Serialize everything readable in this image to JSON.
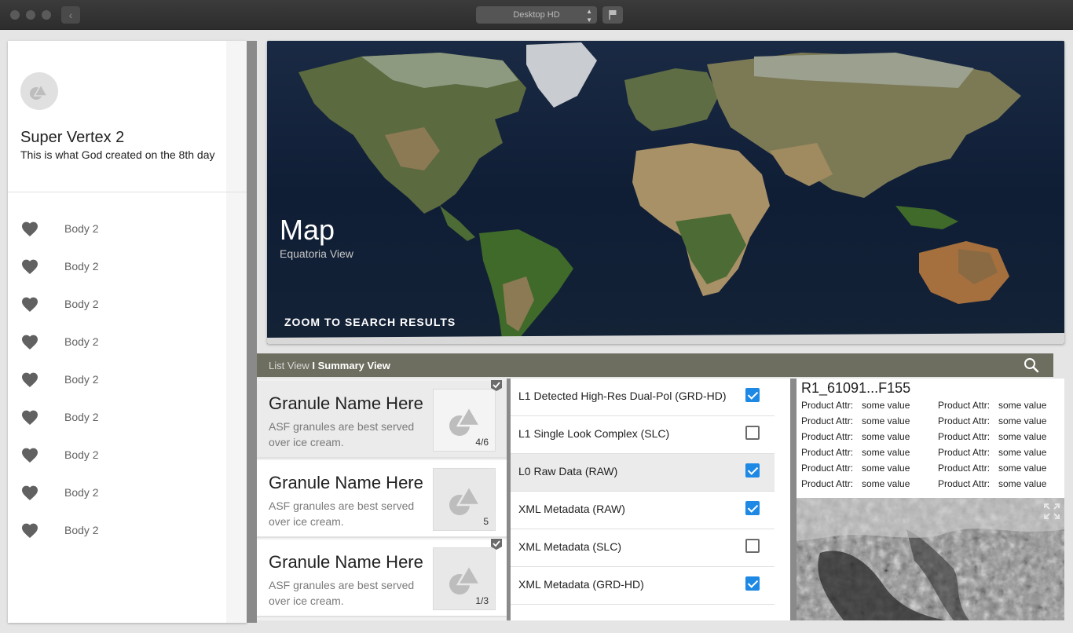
{
  "window": {
    "device_select": "Desktop HD"
  },
  "drawer": {
    "title": "Super Vertex 2",
    "subtitle": "This is what God created on the 8th day",
    "items": [
      {
        "label": "Body 2",
        "icon": "heart-icon"
      },
      {
        "label": "Body 2",
        "icon": "heart-icon"
      },
      {
        "label": "Body 2",
        "icon": "heart-icon"
      },
      {
        "label": "Body 2",
        "icon": "heart-icon"
      },
      {
        "label": "Body 2",
        "icon": "heart-icon"
      },
      {
        "label": "Body 2",
        "icon": "heart-icon"
      },
      {
        "label": "Body 2",
        "icon": "heart-icon"
      },
      {
        "label": "Body 2",
        "icon": "heart-icon"
      },
      {
        "label": "Body 2",
        "icon": "heart-icon"
      }
    ]
  },
  "map": {
    "title": "Map",
    "subtitle": "Equatoria View",
    "zoom_button": "ZOOM TO SEARCH RESULTS"
  },
  "toolbar": {
    "list_view": "List View",
    "separator": " I ",
    "summary_view": "Summary View"
  },
  "granules": [
    {
      "name": "Granule Name Here",
      "description": "ASF granules are best served over ice cream.",
      "count": "4/6",
      "selected": true,
      "checked": true
    },
    {
      "name": "Granule Name Here",
      "description": "ASF granules are best served over ice cream.",
      "count": "5",
      "selected": false,
      "checked": false
    },
    {
      "name": "Granule Name Here",
      "description": "ASF granules are best served over ice cream.",
      "count": "1/3",
      "selected": false,
      "checked": true
    }
  ],
  "products": [
    {
      "label": "L1 Detected High-Res Dual-Pol (GRD-HD)",
      "checked": true,
      "selected": false
    },
    {
      "label": "L1 Single Look Complex (SLC)",
      "checked": false,
      "selected": false
    },
    {
      "label": "L0 Raw Data (RAW)",
      "checked": true,
      "selected": true
    },
    {
      "label": "XML Metadata (RAW)",
      "checked": true,
      "selected": false
    },
    {
      "label": "XML Metadata (SLC)",
      "checked": false,
      "selected": false
    },
    {
      "label": "XML Metadata (GRD-HD)",
      "checked": true,
      "selected": false
    }
  ],
  "detail": {
    "title": "R1_61091...F155",
    "attributes": [
      {
        "name": "Product Attr:",
        "value": "some value"
      },
      {
        "name": "Product Attr:",
        "value": "some value"
      },
      {
        "name": "Product Attr:",
        "value": "some value"
      },
      {
        "name": "Product Attr:",
        "value": "some value"
      },
      {
        "name": "Product Attr:",
        "value": "some value"
      },
      {
        "name": "Product Attr:",
        "value": "some value"
      },
      {
        "name": "Product Attr:",
        "value": "some value"
      },
      {
        "name": "Product Attr:",
        "value": "some value"
      },
      {
        "name": "Product Attr:",
        "value": "some value"
      },
      {
        "name": "Product Attr:",
        "value": "some value"
      },
      {
        "name": "Product Attr:",
        "value": "some value"
      },
      {
        "name": "Product Attr:",
        "value": "some value"
      }
    ]
  },
  "colors": {
    "toolbar": "#6e6e60",
    "checkbox_on": "#1e88e5",
    "divider": "#8a8a8a"
  }
}
